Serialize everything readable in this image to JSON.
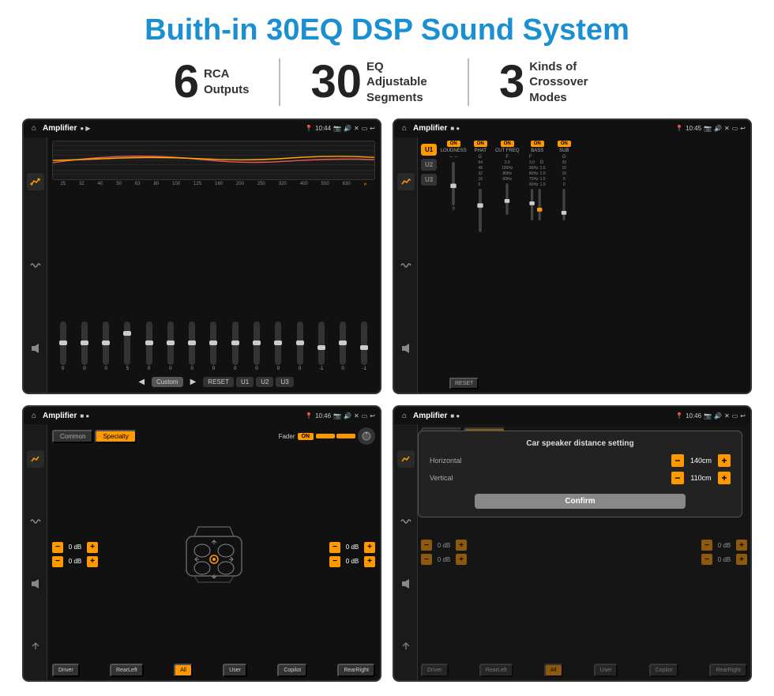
{
  "page": {
    "title": "Buith-in 30EQ DSP Sound System",
    "bg_color": "#ffffff"
  },
  "stats": [
    {
      "number": "6",
      "label": "RCA\nOutputs"
    },
    {
      "number": "30",
      "label": "EQ Adjustable\nSegments"
    },
    {
      "number": "3",
      "label": "Kinds of\nCrossover Modes"
    }
  ],
  "screens": [
    {
      "id": "screen1",
      "status_bar": {
        "app": "Amplifier",
        "icons": "▶",
        "time": "10:44"
      },
      "type": "eq",
      "freqs": [
        "25",
        "32",
        "40",
        "50",
        "63",
        "80",
        "100",
        "125",
        "160",
        "200",
        "250",
        "320",
        "400",
        "500",
        "630"
      ],
      "values": [
        "0",
        "0",
        "0",
        "5",
        "0",
        "0",
        "0",
        "0",
        "0",
        "0",
        "0",
        "0",
        "-1",
        "0",
        "-1"
      ],
      "preset": "Custom",
      "buttons": [
        "◀",
        "Custom",
        "▶",
        "RESET",
        "U1",
        "U2",
        "U3"
      ]
    },
    {
      "id": "screen2",
      "status_bar": {
        "app": "Amplifier",
        "time": "10:45"
      },
      "type": "amplifier",
      "u_buttons": [
        "U1",
        "U2",
        "U3"
      ],
      "channels": [
        {
          "name": "LOUDNESS",
          "on": true
        },
        {
          "name": "PHAT",
          "on": true
        },
        {
          "name": "CUT FREQ",
          "on": true
        },
        {
          "name": "BASS",
          "on": true
        },
        {
          "name": "SUB",
          "on": true
        }
      ],
      "reset_label": "RESET"
    },
    {
      "id": "screen3",
      "status_bar": {
        "app": "Amplifier",
        "time": "10:46"
      },
      "type": "fader",
      "tabs": [
        "Common",
        "Specialty"
      ],
      "fader_label": "Fader",
      "on_label": "ON",
      "volumes": [
        {
          "label": "",
          "value": "0 dB"
        },
        {
          "label": "",
          "value": "0 dB"
        },
        {
          "label": "",
          "value": "0 dB"
        },
        {
          "label": "",
          "value": "0 dB"
        }
      ],
      "bottom_buttons": [
        "Driver",
        "RearLeft",
        "All",
        "User",
        "Copilot",
        "RearRight"
      ]
    },
    {
      "id": "screen4",
      "status_bar": {
        "app": "Amplifier",
        "time": "10:46"
      },
      "type": "distance",
      "tabs": [
        "Common",
        "Specialty"
      ],
      "dialog": {
        "title": "Car speaker distance setting",
        "horizontal_label": "Horizontal",
        "horizontal_value": "140cm",
        "vertical_label": "Vertical",
        "vertical_value": "110cm",
        "confirm_label": "Confirm"
      },
      "volumes": [
        {
          "value": "0 dB"
        },
        {
          "value": "0 dB"
        }
      ],
      "bottom_buttons": [
        "Driver",
        "RearLeft",
        "All",
        "User",
        "Copilot",
        "RearRight"
      ]
    }
  ]
}
